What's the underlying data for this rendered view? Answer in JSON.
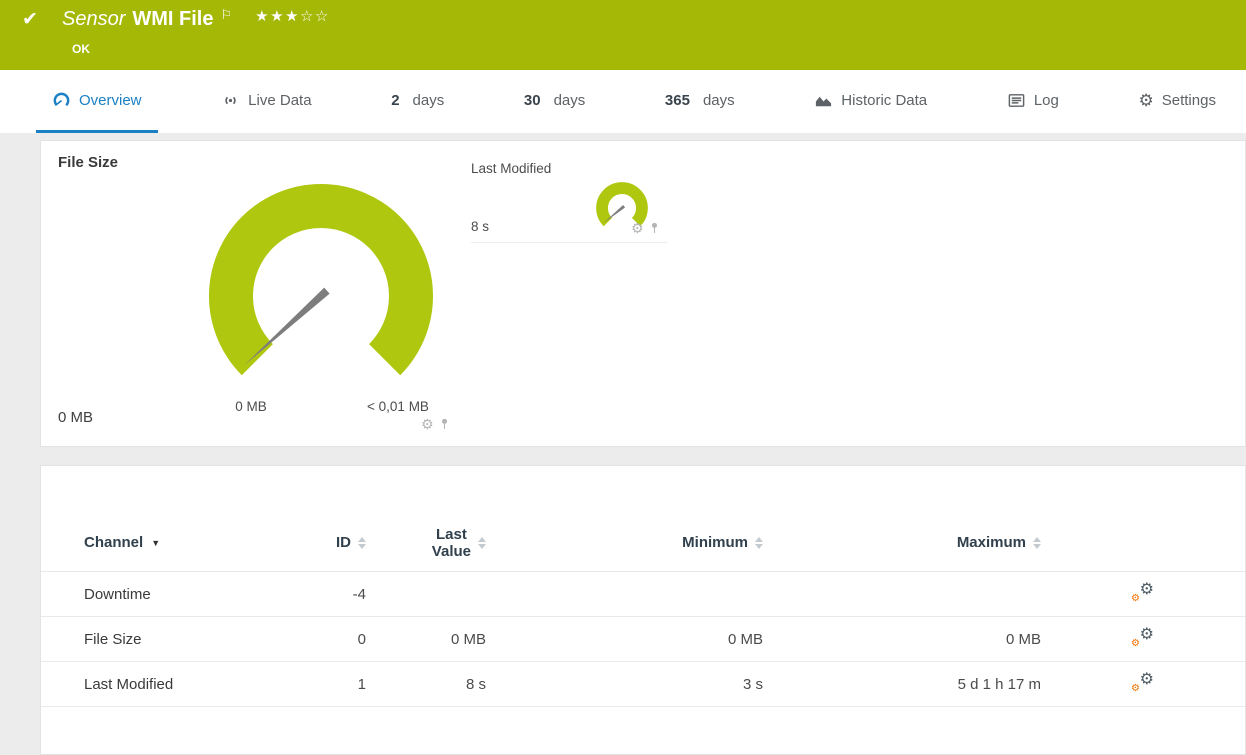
{
  "colors": {
    "header_bg": "#a4b805",
    "gauge_green": "#afc70f",
    "accent_blue": "#1c80c4",
    "needle_gray": "#7d7d7d",
    "gear_orange": "#ef7100"
  },
  "icons": {
    "check": "✔",
    "flag": "⚐",
    "gear": "⚙",
    "sort_active": "▼"
  },
  "header": {
    "title_prefix": "Sensor",
    "title": "WMI File",
    "status": "OK",
    "stars": {
      "filled": "★★★",
      "empty": "☆☆"
    }
  },
  "tabs": {
    "overview": {
      "label": "Overview"
    },
    "live_data": {
      "label": "Live Data"
    },
    "days2": {
      "num": "2",
      "unit": "days"
    },
    "days30": {
      "num": "30",
      "unit": "days"
    },
    "days365": {
      "num": "365",
      "unit": "days"
    },
    "historic": {
      "label": "Historic Data"
    },
    "log": {
      "label": "Log"
    },
    "settings": {
      "label": "Settings"
    }
  },
  "gauges": {
    "file_size": {
      "title": "File Size",
      "current_value": "0 MB",
      "min_label": "0 MB",
      "max_label": "< 0,01 MB"
    },
    "last_modified": {
      "title": "Last Modified",
      "current_value": "8 s"
    }
  },
  "table": {
    "headers": {
      "channel": "Channel",
      "id": "ID",
      "last_value_line1": "Last",
      "last_value_line2": "Value",
      "minimum": "Minimum",
      "maximum": "Maximum"
    },
    "rows": [
      {
        "channel": "Downtime",
        "id": "-4",
        "last_value": "",
        "minimum": "",
        "maximum": ""
      },
      {
        "channel": "File Size",
        "id": "0",
        "last_value": "0 MB",
        "minimum": "0 MB",
        "maximum": "0 MB"
      },
      {
        "channel": "Last Modified",
        "id": "1",
        "last_value": "8 s",
        "minimum": "3 s",
        "maximum": "5 d 1 h 17 m"
      }
    ]
  },
  "chart_data": [
    {
      "type": "gauge",
      "title": "File Size",
      "value": 0,
      "min": 0,
      "max": 0.01,
      "unit": "MB",
      "value_label": "0 MB",
      "min_label": "0 MB",
      "max_label": "< 0,01 MB"
    },
    {
      "type": "gauge",
      "title": "Last Modified",
      "value": 8,
      "unit": "s",
      "value_label": "8 s"
    }
  ]
}
